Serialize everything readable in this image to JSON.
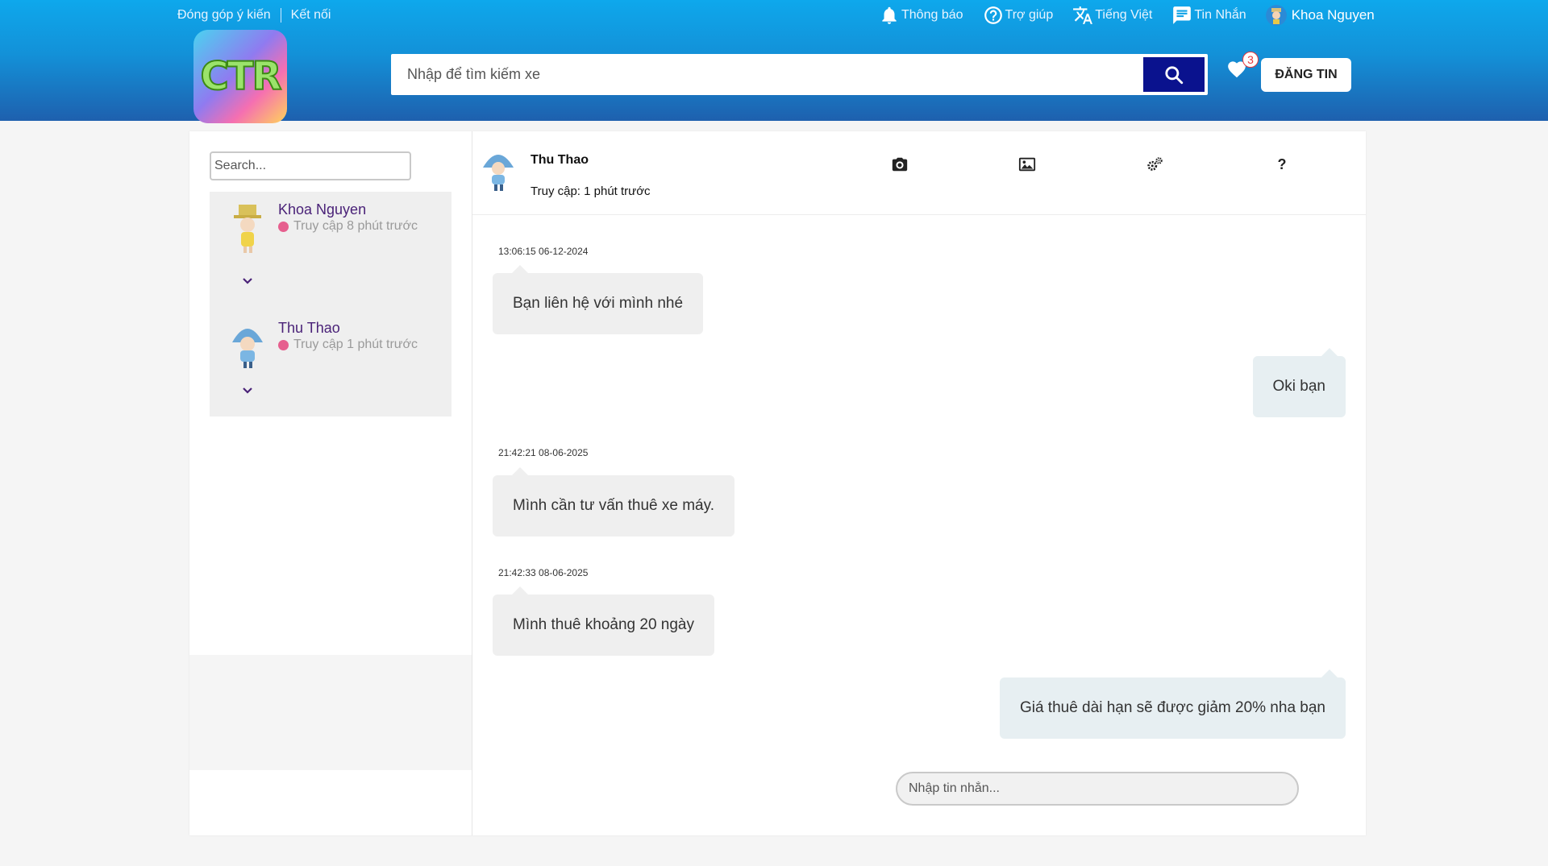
{
  "header": {
    "top_links": [
      "Đóng góp ý kiến",
      "Kết nối"
    ],
    "nav": {
      "notifications": "Thông báo",
      "help": "Trợ giúp",
      "language": "Tiếng Việt",
      "messages": "Tin Nhắn"
    },
    "user_name": "Khoa Nguyen",
    "logo_text": "CTR",
    "search_placeholder": "Nhập để tìm kiếm xe",
    "favorites_count": "3",
    "post_button": "ĐĂNG TIN"
  },
  "sidebar": {
    "search_placeholder": "Search...",
    "contacts": [
      {
        "name": "Khoa Nguyen",
        "status": "Truy cập 8 phút trước"
      },
      {
        "name": "Thu Thao",
        "status": "Truy cập 1 phút trước"
      }
    ]
  },
  "chat": {
    "contact_name": "Thu Thao",
    "contact_status": "Truy cập: 1 phút trước",
    "tool_icons": [
      "camera-icon",
      "image-icon",
      "gears-icon",
      "question-icon"
    ],
    "messages": [
      {
        "timestamp": "13:06:15 06-12-2024",
        "text": "Bạn liên hệ với mình nhé",
        "direction": "in"
      },
      {
        "timestamp": "",
        "text": "Oki bạn",
        "direction": "out"
      },
      {
        "timestamp": "21:42:21 08-06-2025",
        "text": "Mình cần tư vấn thuê xe máy.",
        "direction": "in"
      },
      {
        "timestamp": "21:42:33 08-06-2025",
        "text": "Mình thuê khoảng 20 ngày",
        "direction": "in"
      },
      {
        "timestamp": "",
        "text": "Giá thuê dài hạn sẽ được giảm 20% nha bạn",
        "direction": "out"
      }
    ],
    "input_placeholder": "Nhập tin nhắn..."
  },
  "colors": {
    "header_top": "#0ea8ec",
    "header_bottom": "#1e60ae",
    "search_button": "#0a128e",
    "contact_name": "#4a2278",
    "status_dot": "#e65f8e",
    "incoming_bubble": "#efefef",
    "outgoing_bubble": "#e7eff2"
  }
}
